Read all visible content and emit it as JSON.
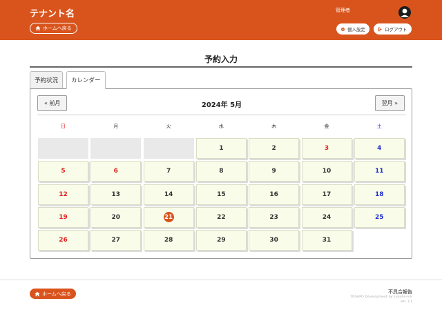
{
  "header": {
    "tenant_name": "テナント名",
    "home_label": "ホームへ戻る",
    "user_role": "管理者",
    "settings_label": "個人設定",
    "logout_label": "ログアウト",
    "background_color": "#d9541c"
  },
  "page": {
    "title": "予約入力"
  },
  "tabs": [
    {
      "label": "予約状況",
      "active": false
    },
    {
      "label": "カレンダー",
      "active": true
    }
  ],
  "calendar": {
    "prev_label": "« 前月",
    "next_label": "翌月 »",
    "month_title": "2024年 5月",
    "weekdays": [
      "日",
      "月",
      "火",
      "水",
      "木",
      "金",
      "土"
    ],
    "weeks": [
      [
        "",
        "",
        "",
        "1",
        "2",
        "3",
        "4"
      ],
      [
        "5",
        "6",
        "7",
        "8",
        "9",
        "10",
        "11"
      ],
      [
        "12",
        "13",
        "14",
        "15",
        "16",
        "17",
        "18"
      ],
      [
        "19",
        "20",
        "21",
        "22",
        "23",
        "24",
        "25"
      ],
      [
        "26",
        "27",
        "28",
        "29",
        "30",
        "31",
        ""
      ]
    ],
    "holidays_red": [
      "3",
      "6"
    ],
    "today": "21",
    "colors": {
      "sunday": "#e02020",
      "saturday": "#1f2fd0",
      "today": "#d9541c",
      "cell": "#f8fce8"
    }
  },
  "footer": {
    "home_label": "ホームへ戻る",
    "report_label": "不具合報告",
    "dev_credit": "YOSAPO Development by sunoho-ink",
    "version": "Ver. 3.1"
  }
}
